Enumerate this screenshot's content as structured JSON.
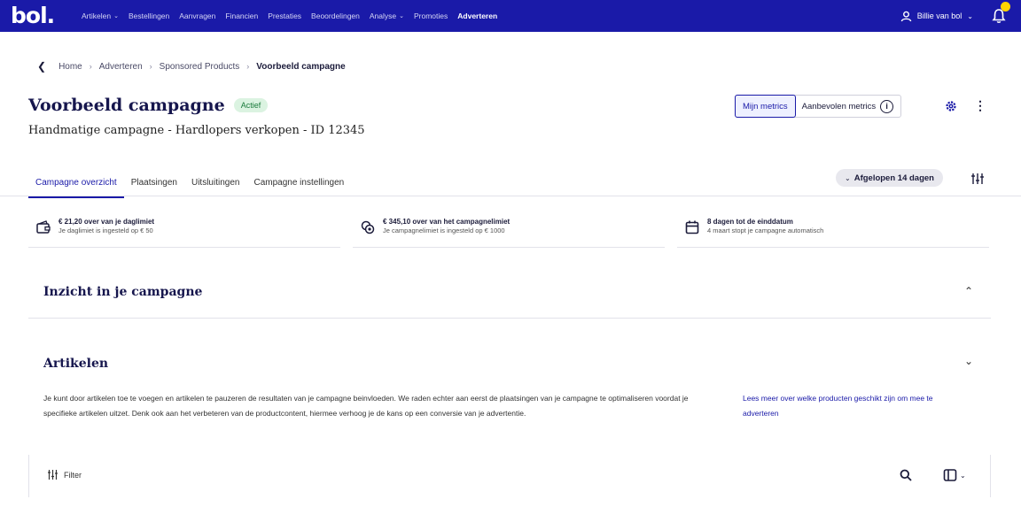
{
  "topbar": {
    "logo": "bol.",
    "nav": [
      {
        "label": "Artikelen",
        "dropdown": true
      },
      {
        "label": "Bestellingen",
        "dropdown": false
      },
      {
        "label": "Aanvragen",
        "dropdown": false
      },
      {
        "label": "Financien",
        "dropdown": false
      },
      {
        "label": "Prestaties",
        "dropdown": false
      },
      {
        "label": "Beoordelingen",
        "dropdown": false
      },
      {
        "label": "Analyse",
        "dropdown": true
      },
      {
        "label": "Promoties",
        "dropdown": false
      },
      {
        "label": "Adverteren",
        "dropdown": false,
        "active": true
      }
    ],
    "user": "Billie van bol",
    "brand_color": "#1a1aa8",
    "badge_color": "#ffd400"
  },
  "breadcrumb": {
    "back_icon": "chevron-left-icon",
    "items": [
      "Home",
      "Adverteren",
      "Sponsored Products"
    ],
    "current": "Voorbeeld campagne"
  },
  "header": {
    "title": "Voorbeeld campagne",
    "status": "Actief",
    "subtitle": "Handmatige campagne - Hardlopers verkopen - ID 12345",
    "metrics": {
      "mine": "Mijn metrics",
      "recommended": "Aanbevolen metrics"
    }
  },
  "tabs": [
    "Campagne overzicht",
    "Plaatsingen",
    "Uitsluitingen",
    "Campagne instellingen"
  ],
  "period": "Afgelopen 14 dagen",
  "cards": [
    {
      "icon": "wallet-icon",
      "title": "€ 21,20 over van je daglimiet",
      "sub": "Je daglimiet is ingesteld op € 50"
    },
    {
      "icon": "coins-icon",
      "title": "€ 345,10 over van het campagnelimiet",
      "sub": "Je campagnelimiet is ingesteld op € 1000"
    },
    {
      "icon": "calendar-icon",
      "title": "8 dagen tot de einddatum",
      "sub": "4 maart stopt je campagne automatisch"
    }
  ],
  "sections": {
    "insight": "Inzicht in je campagne",
    "articles": "Artikelen",
    "articles_desc": "Je kunt door artikelen toe te voegen en artikelen te pauzeren de resultaten van je campagne beinvloeden. We raden echter aan eerst de plaatsingen van je campagne te optimaliseren voordat je specifieke artikelen uitzet. Denk ook aan het verbeteren van de productcontent, hiermee verhoog je de kans op een conversie van je advertentie.",
    "articles_link": "Lees meer over welke producten geschikt zijn om mee te adverteren"
  },
  "filter": {
    "label": "Filter"
  }
}
